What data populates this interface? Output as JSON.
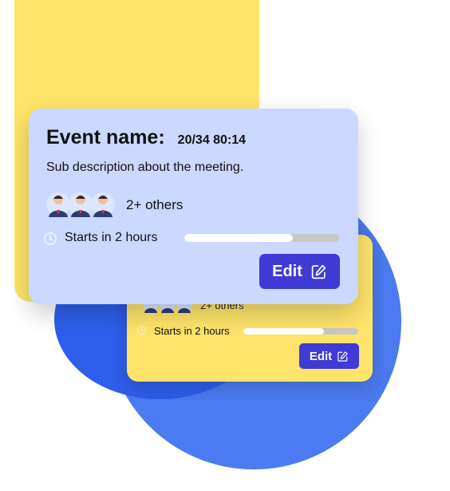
{
  "colors": {
    "yellow": "#FEE46A",
    "front_card": "#CBD8FF",
    "circle_light": "#4C7BF1",
    "circle_dark": "#2E5EEB",
    "button": "#3F3BD6",
    "progress_track": "#C8C8C8",
    "progress_fill": "#FFFFFF"
  },
  "front_card": {
    "event_label": "Event name:",
    "event_time": "20/34 80:14",
    "description": "Sub description about the meeting.",
    "others_label": "2+ others",
    "starts_label": "Starts in 2 hours",
    "progress_fraction": 0.7,
    "edit_label": "Edit",
    "icons": [
      "person-avatar-icon",
      "clock-icon",
      "edit-icon"
    ]
  },
  "back_card": {
    "others_label": "2+ others",
    "starts_label": "Starts in 2 hours",
    "progress_fraction": 0.7,
    "edit_label": "Edit",
    "icons": [
      "person-avatar-icon",
      "clock-icon",
      "edit-icon"
    ]
  }
}
